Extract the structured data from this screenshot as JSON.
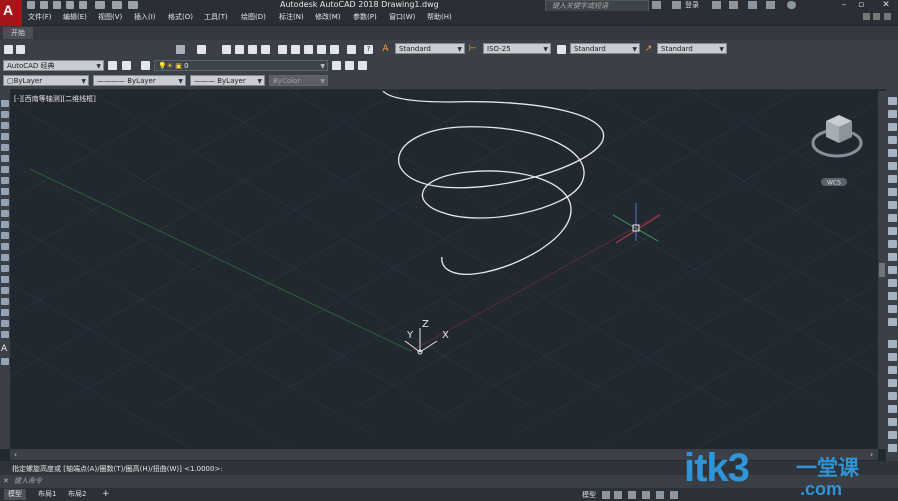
{
  "app": {
    "logo_letter": "A",
    "title": "Autodesk AutoCAD 2018    Drawing1.dwg",
    "search_placeholder": "键入关键字或短语",
    "login": "登录"
  },
  "menu": [
    "文件(F)",
    "编辑(E)",
    "视图(V)",
    "插入(I)",
    "格式(O)",
    "工具(T)",
    "绘图(D)",
    "标注(N)",
    "修改(M)",
    "参数(P)",
    "窗口(W)",
    "帮助(H)"
  ],
  "tabs": {
    "start": "开始"
  },
  "toolbar1": {
    "text_style": "Standard",
    "dim_style": "ISO-25",
    "table_style": "Standard",
    "mleader_style": "Standard"
  },
  "toolbar2": {
    "workspace": "AutoCAD 经典",
    "layer": "0"
  },
  "toolbar3": {
    "color": "ByLayer",
    "linetype": "ByLayer",
    "lineweight": "ByLayer",
    "plotstyle": "ByColor"
  },
  "viewport": {
    "label": "[-][西南等轴测][二维线框]",
    "ucs_x": "X",
    "ucs_y": "Y",
    "ucs_z": "Z",
    "wcs": "WCS"
  },
  "command": {
    "history": "指定螺旋高度或 [轴端点(A)/圈数(T)/圈高(H)/扭曲(W)] <1.0000>:",
    "prompt": "键入命令"
  },
  "status": {
    "model_tab": "模型",
    "layout1": "布局1",
    "layout2": "布局2",
    "add": "+",
    "model_btn": "模型"
  },
  "watermark": {
    "main": "itk3",
    "cn": "一堂课",
    "com": ".com"
  },
  "colors": {
    "background": "#212830",
    "helix": "#e8e8e8",
    "accent": "#a5151a",
    "watermark": "#2f95d6"
  }
}
